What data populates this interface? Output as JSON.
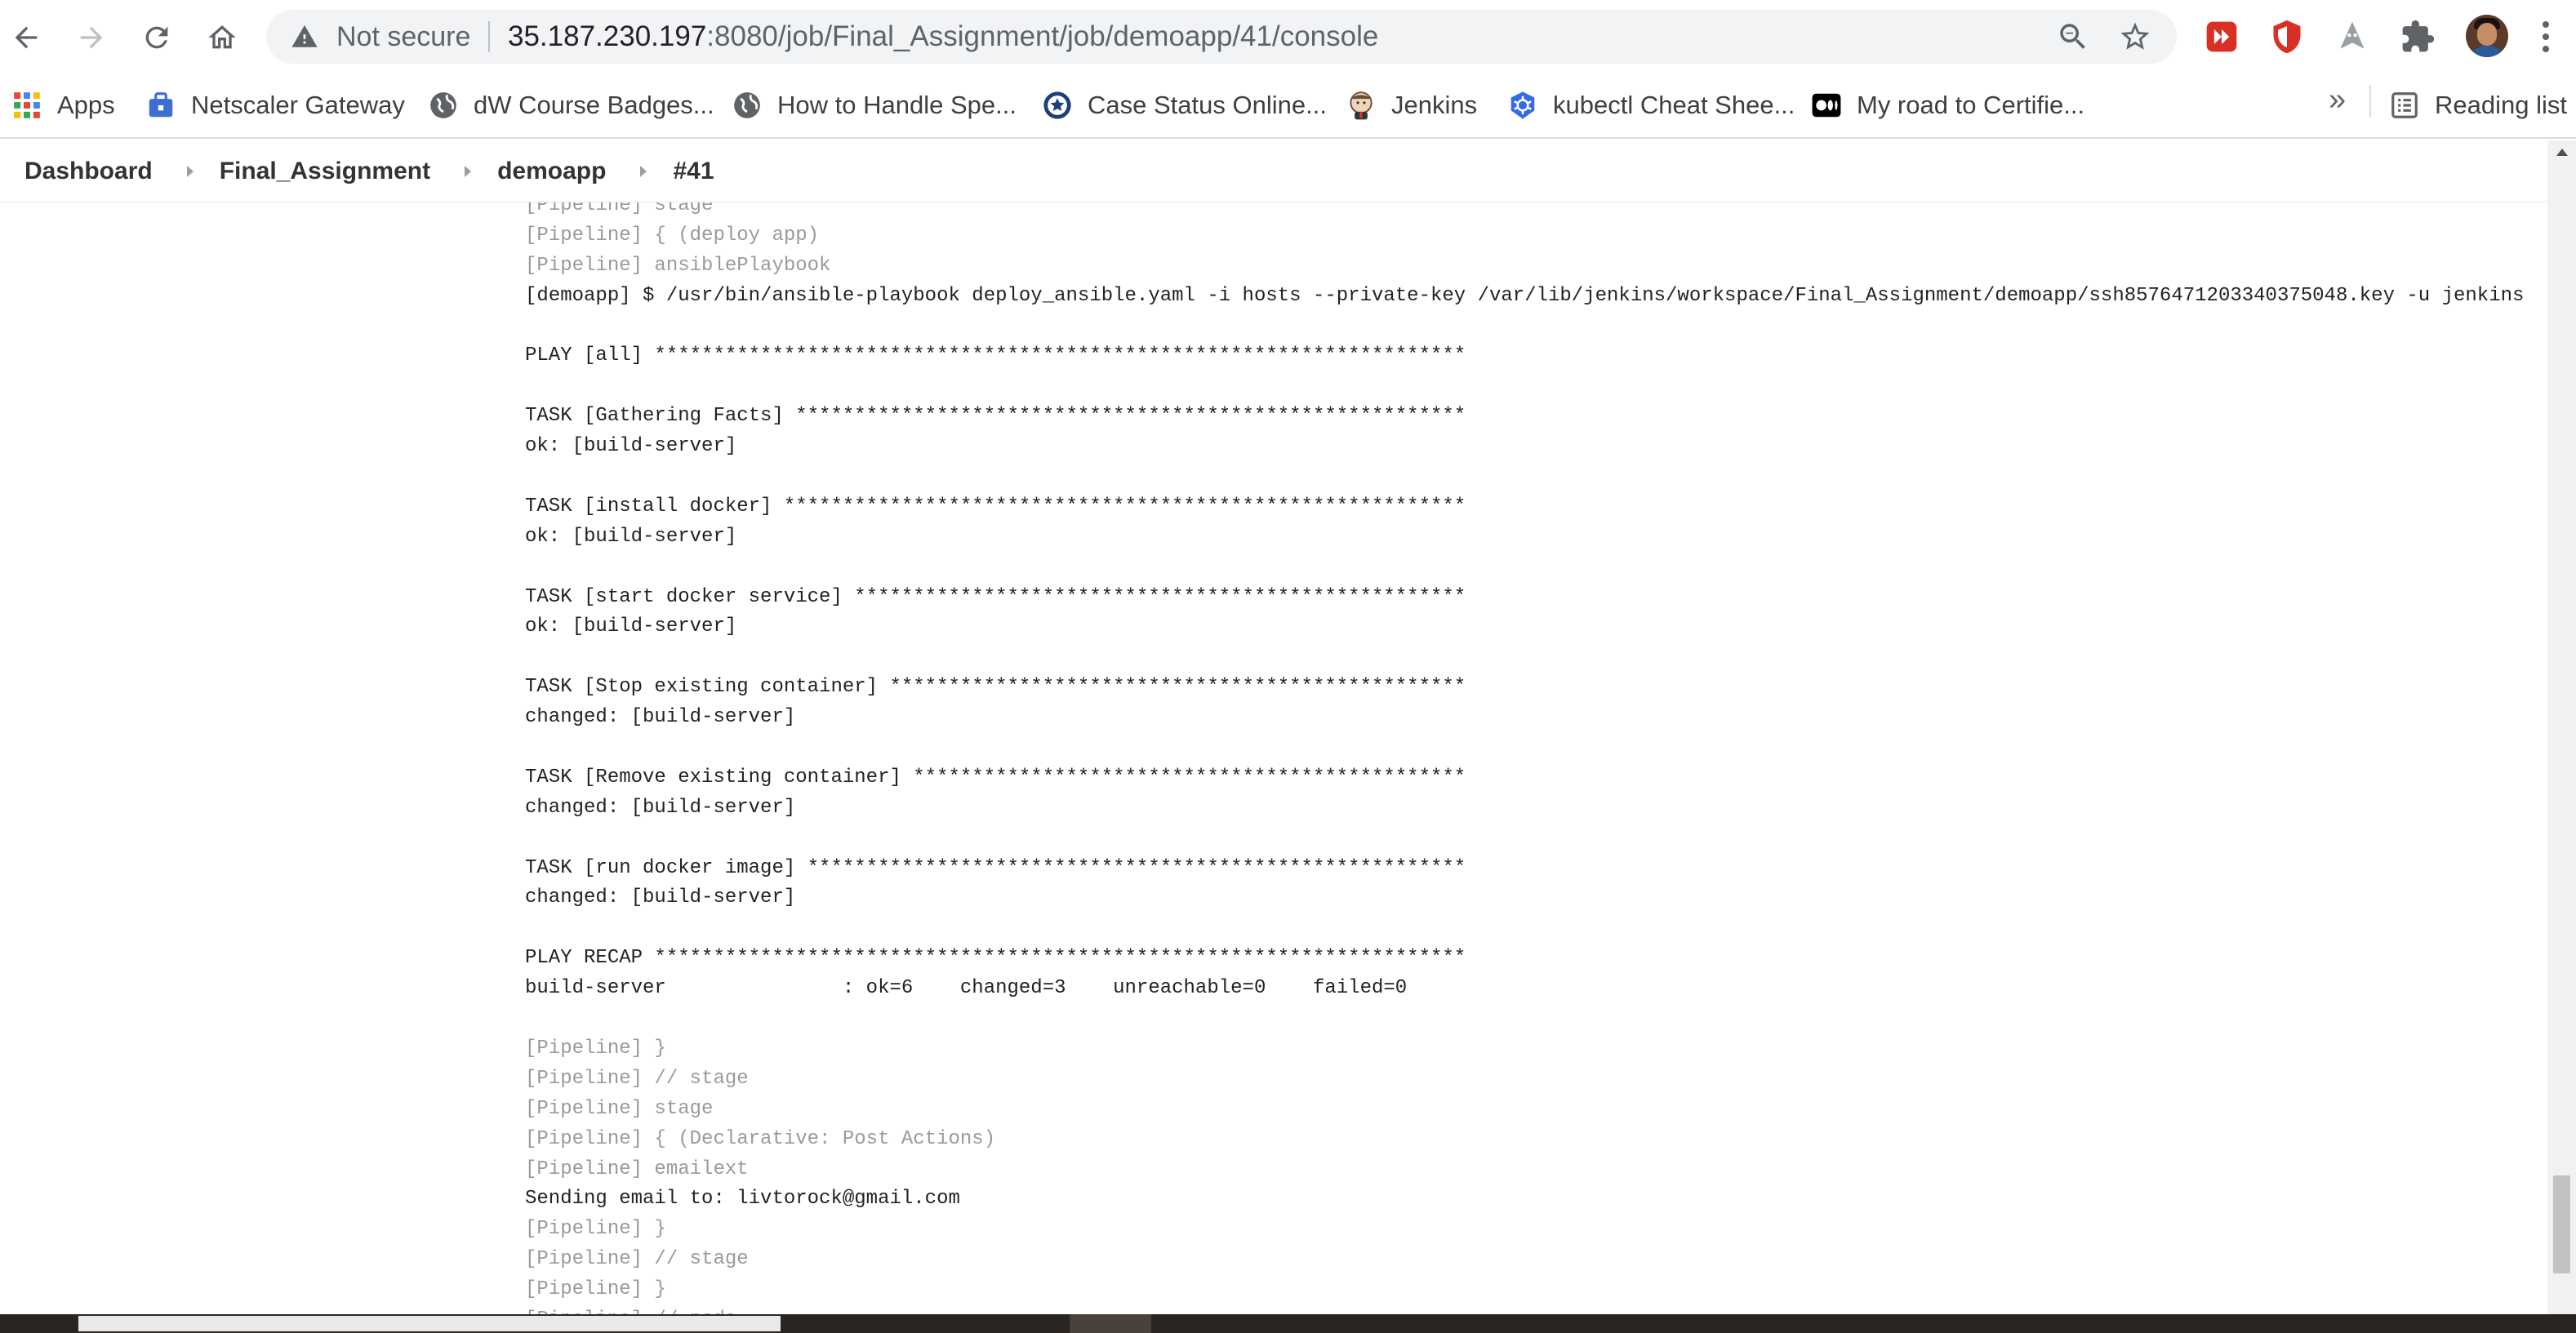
{
  "browser": {
    "security_label": "Not secure",
    "url_host": "35.187.230.197",
    "url_rest": ":8080/job/Final_Assignment/job/demoapp/41/console",
    "nav_icons": [
      "back-arrow-icon",
      "forward-arrow-icon",
      "reload-icon",
      "home-icon"
    ],
    "extensions": [
      "red-play-extension-icon",
      "red-shield-extension-icon",
      "gray-ghost-extension-icon",
      "puzzle-extensions-icon"
    ]
  },
  "bookmarks": {
    "items": [
      {
        "label": "Apps",
        "icon": "apps-grid-icon"
      },
      {
        "label": "Netscaler Gateway",
        "icon": "briefcase-lock-icon"
      },
      {
        "label": "dW Course Badges...",
        "icon": "globe-icon"
      },
      {
        "label": "How to Handle Spe...",
        "icon": "globe-icon"
      },
      {
        "label": "Case Status Online...",
        "icon": "seal-icon"
      },
      {
        "label": "Jenkins",
        "icon": "jenkins-butler-icon"
      },
      {
        "label": "kubectl Cheat Shee...",
        "icon": "kubernetes-helm-icon"
      },
      {
        "label": "My road to Certifie...",
        "icon": "medium-logo-icon"
      }
    ],
    "overflow": "»",
    "reading_list": "Reading list"
  },
  "breadcrumb": {
    "items": [
      "Dashboard",
      "Final_Assignment",
      "demoapp",
      "#41"
    ]
  },
  "console": {
    "lines": [
      {
        "text": "[Pipeline] stage",
        "kind": "pipe"
      },
      {
        "text": "[Pipeline] { (deploy app)",
        "kind": "pipe"
      },
      {
        "text": "[Pipeline] ansiblePlaybook",
        "kind": "pipe"
      },
      {
        "text": "[demoapp] $ /usr/bin/ansible-playbook deploy_ansible.yaml -i hosts --private-key /var/lib/jenkins/workspace/Final_Assignment/demoapp/ssh8576471203340375048.key -u jenkins",
        "kind": "out"
      },
      {
        "text": "",
        "kind": "out"
      },
      {
        "text": "PLAY [all] *********************************************************************",
        "kind": "out"
      },
      {
        "text": "",
        "kind": "out"
      },
      {
        "text": "TASK [Gathering Facts] *********************************************************",
        "kind": "out"
      },
      {
        "text": "ok: [build-server]",
        "kind": "out"
      },
      {
        "text": "",
        "kind": "out"
      },
      {
        "text": "TASK [install docker] **********************************************************",
        "kind": "out"
      },
      {
        "text": "ok: [build-server]",
        "kind": "out"
      },
      {
        "text": "",
        "kind": "out"
      },
      {
        "text": "TASK [start docker service] ****************************************************",
        "kind": "out"
      },
      {
        "text": "ok: [build-server]",
        "kind": "out"
      },
      {
        "text": "",
        "kind": "out"
      },
      {
        "text": "TASK [Stop existing container] *************************************************",
        "kind": "out"
      },
      {
        "text": "changed: [build-server]",
        "kind": "out"
      },
      {
        "text": "",
        "kind": "out"
      },
      {
        "text": "TASK [Remove existing container] ***********************************************",
        "kind": "out"
      },
      {
        "text": "changed: [build-server]",
        "kind": "out"
      },
      {
        "text": "",
        "kind": "out"
      },
      {
        "text": "TASK [run docker image] ********************************************************",
        "kind": "out"
      },
      {
        "text": "changed: [build-server]",
        "kind": "out"
      },
      {
        "text": "",
        "kind": "out"
      },
      {
        "text": "PLAY RECAP *********************************************************************",
        "kind": "out"
      },
      {
        "text": "build-server               : ok=6    changed=3    unreachable=0    failed=0",
        "kind": "out"
      },
      {
        "text": "",
        "kind": "out"
      },
      {
        "text": "[Pipeline] }",
        "kind": "pipe"
      },
      {
        "text": "[Pipeline] // stage",
        "kind": "pipe"
      },
      {
        "text": "[Pipeline] stage",
        "kind": "pipe"
      },
      {
        "text": "[Pipeline] { (Declarative: Post Actions)",
        "kind": "pipe"
      },
      {
        "text": "[Pipeline] emailext",
        "kind": "pipe"
      },
      {
        "text": "Sending email to: livtorock@gmail.com",
        "kind": "out"
      },
      {
        "text": "[Pipeline] }",
        "kind": "pipe"
      },
      {
        "text": "[Pipeline] // stage",
        "kind": "pipe"
      },
      {
        "text": "[Pipeline] }",
        "kind": "pipe"
      },
      {
        "text": "[Pipeline] // node",
        "kind": "pipe"
      }
    ]
  },
  "colors": {
    "pipeline_text": "#9a9a9a",
    "output_text": "#222222",
    "extension_red": "#d93025"
  }
}
